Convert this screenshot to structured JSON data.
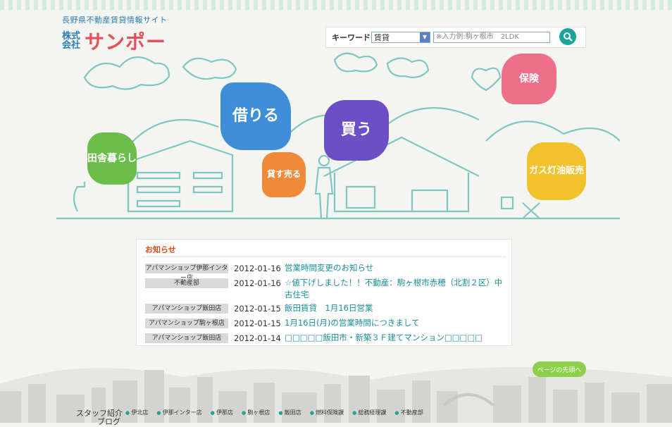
{
  "header": {
    "tagline": "長野県不動産賃貸情報サイト",
    "company_type": "株式会社",
    "brand": "サンポー"
  },
  "search": {
    "label": "キーワード",
    "selected": "賃貸",
    "placeholder": "※入力例:駒ヶ根市　2LDK"
  },
  "hero": {
    "kariru": "借りる",
    "kau": "買う",
    "inaka": "田舎暮らし",
    "kasu": "貸す売る",
    "hoken": "保険",
    "gas": "ガス灯油販売"
  },
  "news": {
    "title": "お知らせ",
    "items": [
      {
        "category": "アパマンショップ伊那インター店",
        "date": "2012-01-16",
        "text": "営業時間変更のお知らせ"
      },
      {
        "category": "不動産部",
        "date": "2012-01-16",
        "text": "☆値下げしました！！不動産：駒ヶ根市赤穂（北割２区）中古住宅"
      },
      {
        "category": "アパマンショップ飯田店",
        "date": "2012-01-15",
        "text": "飯田賃貸　1月16日営業"
      },
      {
        "category": "アパマンショップ駒ヶ根店",
        "date": "2012-01-15",
        "text": "1月16日(月)の営業時間につきまして"
      },
      {
        "category": "アパマンショップ飯田店",
        "date": "2012-01-14",
        "text": "□□□□□飯田市・新築３Ｆ建てマンション□□□□□"
      }
    ]
  },
  "pagetop": "ページの先頭へ",
  "footer": {
    "staff_label": "スタッフ紹介",
    "blog_label": "ブログ",
    "items": [
      "伊北店",
      "伊那インター店",
      "伊那店",
      "駒ヶ根店",
      "飯田店",
      "燃料保険課",
      "総務経理課",
      "不動産部"
    ]
  },
  "colors": {
    "accent": "#1ca39c",
    "brand_red": "#e5505e",
    "news_title": "#d94a1a"
  }
}
